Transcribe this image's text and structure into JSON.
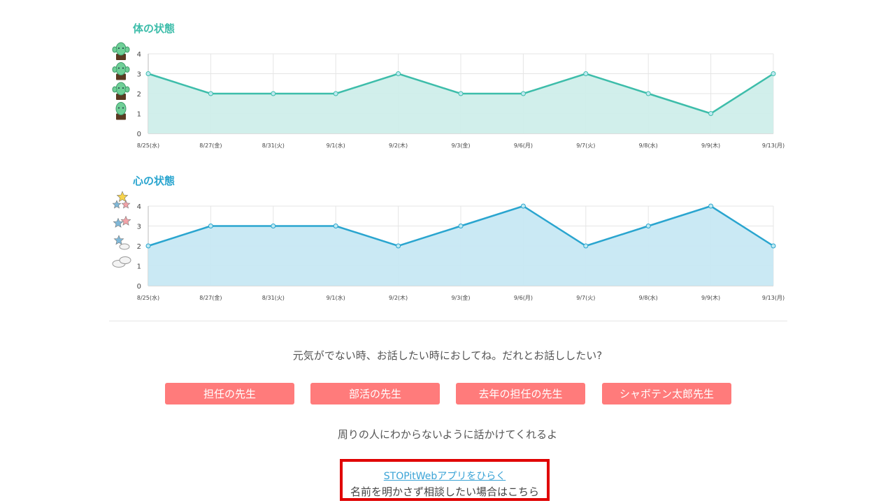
{
  "body_chart": {
    "title": "体の状態",
    "color": "#3dbdaa",
    "fill": "#cfeeea",
    "icon_column": [
      "cactus-happy-icon",
      "cactus-smile-icon",
      "cactus-neutral-icon",
      "cactus-sad-icon"
    ]
  },
  "mind_chart": {
    "title": "心の状態",
    "color": "#2aa5cf",
    "fill": "#c7e8f3",
    "icon_column": [
      "three-stars-icon",
      "two-stars-icon",
      "star-cloud-icon",
      "clouds-icon"
    ]
  },
  "chart_data": [
    {
      "type": "area",
      "title": "体の状態",
      "categories": [
        "8/25(水)",
        "8/27(金)",
        "8/31(火)",
        "9/1(水)",
        "9/2(木)",
        "9/3(金)",
        "9/6(月)",
        "9/7(火)",
        "9/8(水)",
        "9/9(木)",
        "9/13(月)"
      ],
      "values": [
        3,
        2,
        2,
        2,
        3,
        2,
        2,
        3,
        2,
        1,
        3
      ],
      "yticks": [
        "0",
        "1",
        "2",
        "3",
        "4"
      ],
      "ylim": [
        0,
        4
      ],
      "grid": true
    },
    {
      "type": "area",
      "title": "心の状態",
      "categories": [
        "8/25(水)",
        "8/27(金)",
        "8/31(火)",
        "9/1(水)",
        "9/2(木)",
        "9/3(金)",
        "9/6(月)",
        "9/7(火)",
        "9/8(水)",
        "9/9(木)",
        "9/13(月)"
      ],
      "values": [
        2,
        3,
        3,
        3,
        2,
        3,
        4,
        2,
        3,
        4,
        2
      ],
      "yticks": [
        "0",
        "1",
        "2",
        "3",
        "4"
      ],
      "ylim": [
        0,
        4
      ],
      "grid": true
    }
  ],
  "consult": {
    "prompt": "元気がでない時、お話したい時におしてね。だれとお話ししたい?",
    "buttons": [
      "担任の先生",
      "部活の先生",
      "去年の担任の先生",
      "シャボテン太郎先生"
    ],
    "button_color": "#ff7b7b",
    "note": "周りの人にわからないように話かけてくれるよ",
    "web_link": "STOPitWebアプリをひらく",
    "web_sub": "名前を明かさず相談したい場合はこちら"
  }
}
